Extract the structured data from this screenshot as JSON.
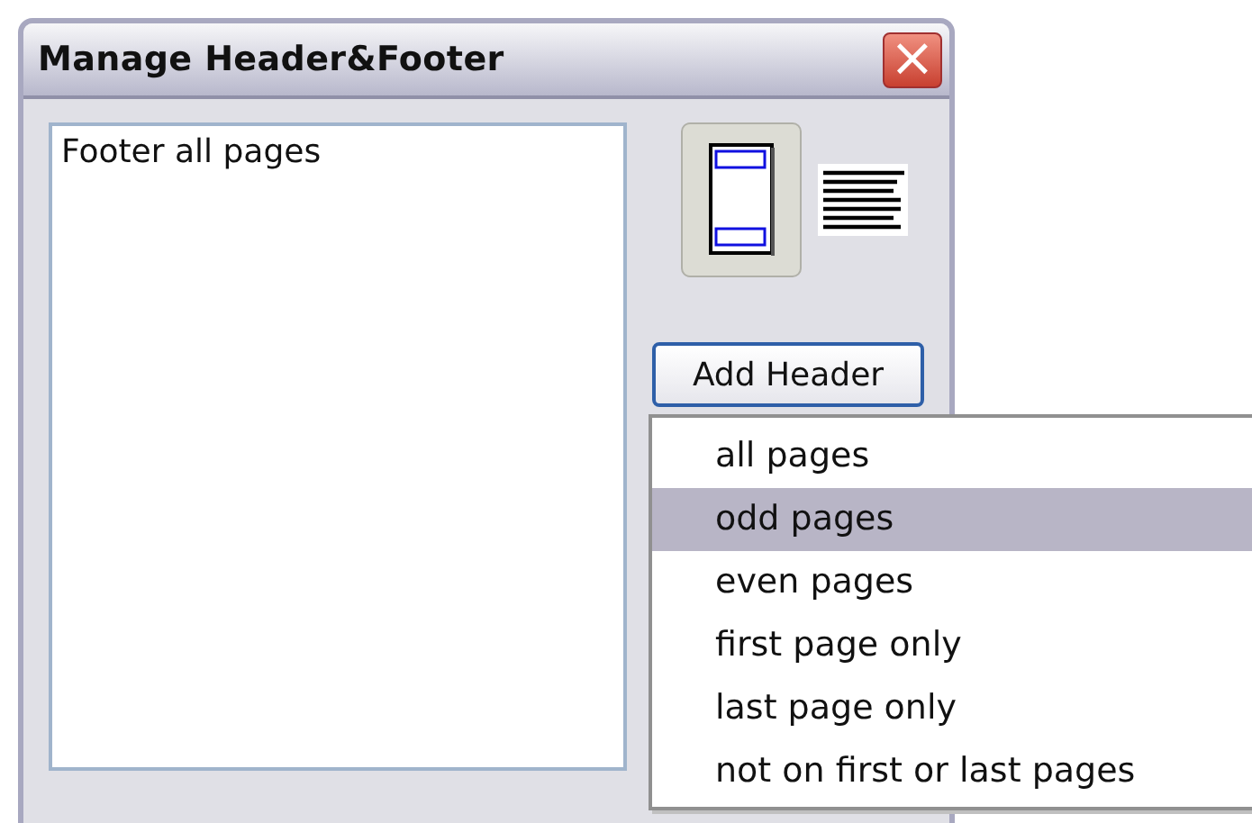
{
  "window": {
    "title": "Manage Header&Footer",
    "close_button": "×"
  },
  "list": {
    "items": [
      {
        "label": "Footer all pages",
        "selected": false
      }
    ]
  },
  "view_toggles": [
    {
      "kind": "page",
      "selected": true
    },
    {
      "kind": "lines",
      "selected": false
    }
  ],
  "add_button": {
    "label": "Add Header"
  },
  "menu": {
    "items": [
      {
        "label": "all pages",
        "selected": false
      },
      {
        "label": "odd pages",
        "selected": true
      },
      {
        "label": "even pages",
        "selected": false
      },
      {
        "label": "first page only",
        "selected": false
      },
      {
        "label": "last page only",
        "selected": false
      },
      {
        "label": "not on first or last pages",
        "selected": false
      }
    ]
  }
}
